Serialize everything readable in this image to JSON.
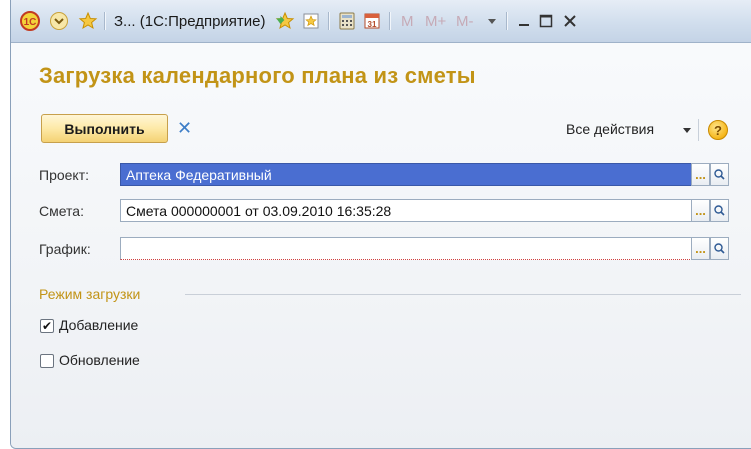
{
  "window": {
    "title": "З... (1С:Предприятие)",
    "memory_buttons": [
      "M",
      "M+",
      "M-"
    ]
  },
  "form": {
    "title": "Загрузка календарного плана из сметы",
    "run_label": "Выполнить",
    "close_symbol": "✕",
    "all_actions_label": "Все действия",
    "help_symbol": "?"
  },
  "fields": [
    {
      "label": "Проект:",
      "value": "Аптека Федеративный",
      "selected": true
    },
    {
      "label": "Смета:",
      "value": "Смета 000000001 от 03.09.2010 16:35:28",
      "selected": false
    },
    {
      "label": "График:",
      "value": "",
      "selected": false
    }
  ],
  "field_buttons": {
    "select": "...",
    "search": "🔍"
  },
  "load_mode": {
    "group_label": "Режим загрузки",
    "options": [
      {
        "label": "Добавление",
        "checked": true
      },
      {
        "label": "Обновление",
        "checked": false
      }
    ]
  },
  "icons": [
    "1c-logo-icon",
    "history-icon",
    "favorites-star-icon",
    "add-favorite-icon",
    "bookmark-icon",
    "calculator-icon",
    "calendar-icon",
    "minimize-icon",
    "maximize-icon",
    "close-icon"
  ],
  "colors": {
    "accent": "#c29417",
    "selection": "#4a6ed1"
  }
}
